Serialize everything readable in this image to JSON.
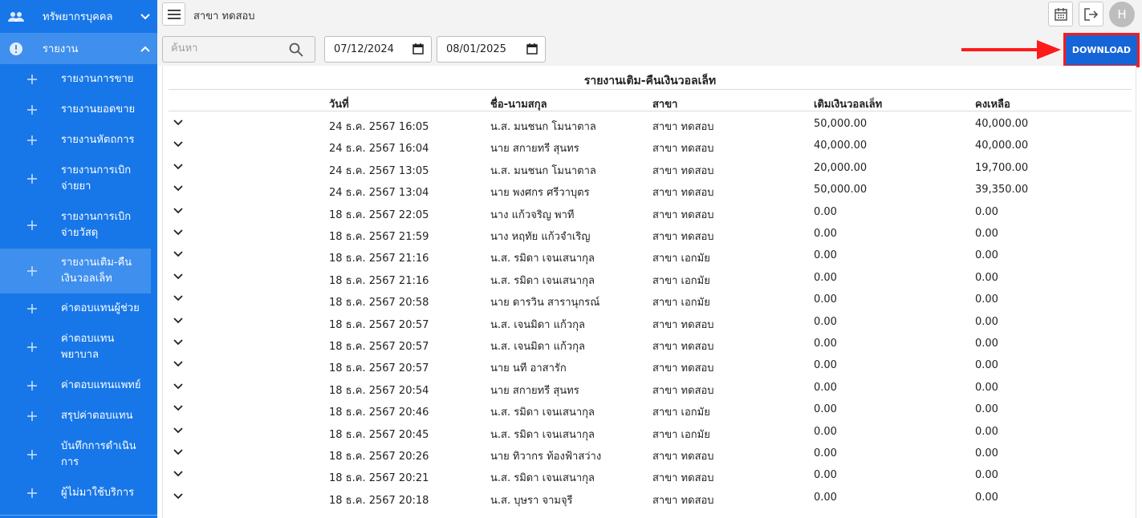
{
  "sidebar": {
    "group_hr": "ทรัพยากรบุคคล",
    "group_report": "รายงาน",
    "items": [
      {
        "label": "รายงานการขาย"
      },
      {
        "label": "รายงานยอดขาย"
      },
      {
        "label": "รายงานหัตถการ"
      },
      {
        "label": "รายงานการเบิกจ่ายยา"
      },
      {
        "label": "รายงานการเบิกจ่ายวัสดุ"
      },
      {
        "label": "รายงานเติม-คืนเงินวอลเล็ท"
      },
      {
        "label": "ค่าตอบแทนผู้ช่วย"
      },
      {
        "label": "ค่าตอบแทนพยาบาล"
      },
      {
        "label": "ค่าตอบแทนแพทย์"
      },
      {
        "label": "สรุปค่าตอบแทน"
      },
      {
        "label": "บันทึกการดำเนินการ"
      },
      {
        "label": "ผู้ไม่มาใช้บริการ"
      }
    ]
  },
  "topbar": {
    "branch": "สาขา ทดสอบ",
    "avatar_letter": "H"
  },
  "filters": {
    "search_placeholder": "ค้นหา",
    "date_from": "07/12/2024",
    "date_to": "08/01/2025",
    "download_label": "DOWNLOAD"
  },
  "report": {
    "title": "รายงานเติม-คืนเงินวอลเล็ท",
    "columns": [
      "วันที่",
      "ชื่อ-นามสกุล",
      "สาขา",
      "เติมเงินวอลเล็ท",
      "คงเหลือ"
    ],
    "rows": [
      [
        "24 ธ.ค. 2567 16:05",
        "น.ส. มนชนก โมนาตาล",
        "สาขา ทดสอบ",
        "50,000.00",
        "40,000.00"
      ],
      [
        "24 ธ.ค. 2567 16:04",
        "นาย สกายทรี สุนทร",
        "สาขา ทดสอบ",
        "40,000.00",
        "40,000.00"
      ],
      [
        "24 ธ.ค. 2567 13:05",
        "น.ส. มนชนก โมนาตาล",
        "สาขา ทดสอบ",
        "20,000.00",
        "19,700.00"
      ],
      [
        "24 ธ.ค. 2567 13:04",
        "นาย พงศกร ศรีวาบุตร",
        "สาขา ทดสอบ",
        "50,000.00",
        "39,350.00"
      ],
      [
        "18 ธ.ค. 2567 22:05",
        "นาง แก้วจริญ พาที",
        "สาขา ทดสอบ",
        "0.00",
        "0.00"
      ],
      [
        "18 ธ.ค. 2567 21:59",
        "นาง หฤทัย แก้วจำเริญ",
        "สาขา ทดสอบ",
        "0.00",
        "0.00"
      ],
      [
        "18 ธ.ค. 2567 21:16",
        "น.ส. รมิดา เจนเสนากุล",
        "สาขา เอกมัย",
        "0.00",
        "0.00"
      ],
      [
        "18 ธ.ค. 2567 21:16",
        "น.ส. รมิดา เจนเสนากุล",
        "สาขา เอกมัย",
        "0.00",
        "0.00"
      ],
      [
        "18 ธ.ค. 2567 20:58",
        "นาย ดารวิน สารานุกรณ์",
        "สาขา เอกมัย",
        "0.00",
        "0.00"
      ],
      [
        "18 ธ.ค. 2567 20:57",
        "น.ส. เจนมิดา แก้วกุล",
        "สาขา ทดสอบ",
        "0.00",
        "0.00"
      ],
      [
        "18 ธ.ค. 2567 20:57",
        "น.ส. เจนมิดา แก้วกุล",
        "สาขา ทดสอบ",
        "0.00",
        "0.00"
      ],
      [
        "18 ธ.ค. 2567 20:57",
        "นาย นที อาสารัก",
        "สาขา ทดสอบ",
        "0.00",
        "0.00"
      ],
      [
        "18 ธ.ค. 2567 20:54",
        "นาย สกายทรี สุนทร",
        "สาขา ทดสอบ",
        "0.00",
        "0.00"
      ],
      [
        "18 ธ.ค. 2567 20:46",
        "น.ส. รมิดา เจนเสนากุล",
        "สาขา เอกมัย",
        "0.00",
        "0.00"
      ],
      [
        "18 ธ.ค. 2567 20:45",
        "น.ส. รมิดา เจนเสนากุล",
        "สาขา เอกมัย",
        "0.00",
        "0.00"
      ],
      [
        "18 ธ.ค. 2567 20:26",
        "นาย ทิวากร ท้องฟ้าสว่าง",
        "สาขา ทดสอบ",
        "0.00",
        "0.00"
      ],
      [
        "18 ธ.ค. 2567 20:21",
        "น.ส. รมิดา เจนเสนากุล",
        "สาขา ทดสอบ",
        "0.00",
        "0.00"
      ],
      [
        "18 ธ.ค. 2567 20:18",
        "น.ส. บุษรา จามจุรี",
        "สาขา ทดสอบ",
        "0.00",
        "0.00"
      ]
    ]
  },
  "colors": {
    "sidebar_bg": "#1877e8",
    "sidebar_active": "#3f8fee",
    "download_bg": "#1565d8",
    "highlight": "#ff1a1a"
  }
}
